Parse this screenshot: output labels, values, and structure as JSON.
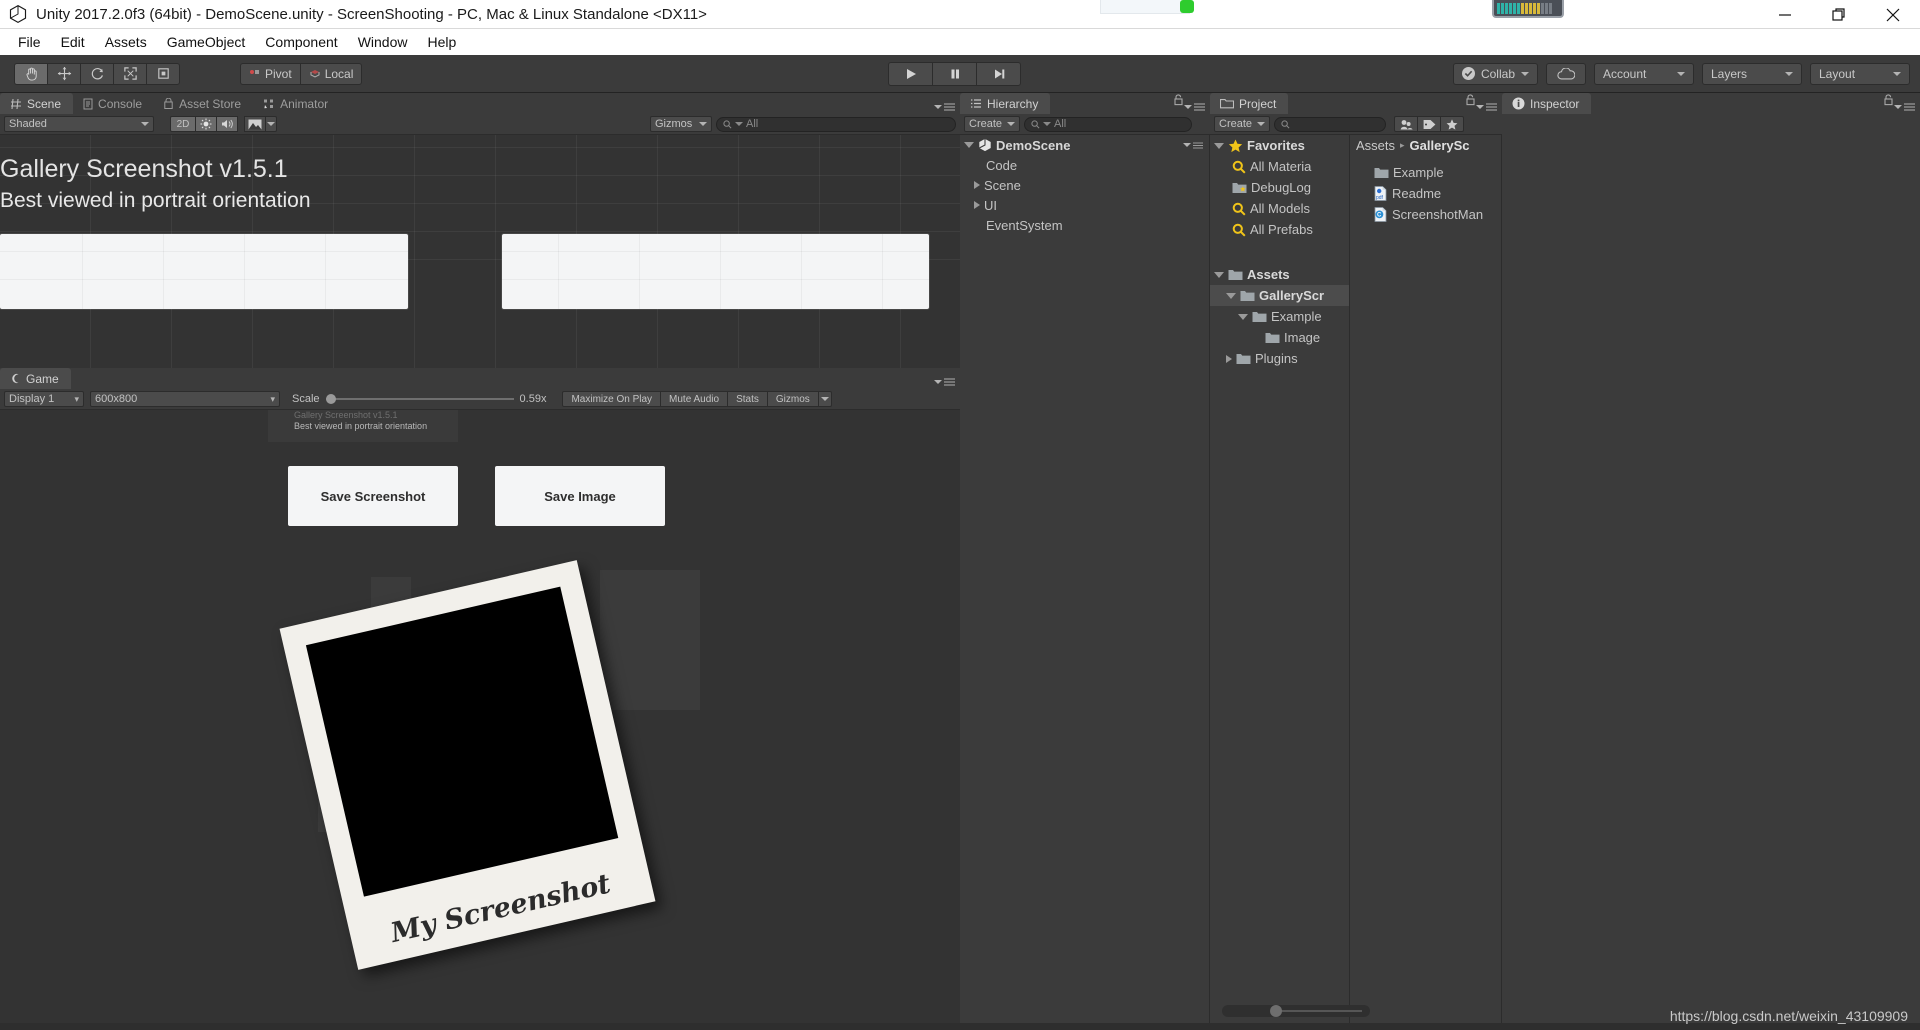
{
  "window": {
    "title": "Unity 2017.2.0f3 (64bit) - DemoScene.unity - ScreenShooting - PC, Mac & Linux Standalone <DX11>",
    "icon": "unity-logo-icon",
    "controls": {
      "minimize": "minimize-icon",
      "maximize": "maximize-icon",
      "close": "close-icon"
    }
  },
  "menubar": {
    "items": [
      "File",
      "Edit",
      "Assets",
      "GameObject",
      "Component",
      "Window",
      "Help"
    ]
  },
  "toolbar": {
    "transform_tools": [
      {
        "name": "hand-tool",
        "glyph": "hand-icon",
        "active": true
      },
      {
        "name": "move-tool",
        "glyph": "move-icon",
        "active": false
      },
      {
        "name": "rotate-tool",
        "glyph": "rotate-icon",
        "active": false
      },
      {
        "name": "scale-tool",
        "glyph": "scale-icon",
        "active": false
      },
      {
        "name": "rect-tool",
        "glyph": "rect-transform-icon",
        "active": false
      }
    ],
    "pivot_label": "Pivot",
    "local_label": "Local",
    "play_label": "play-icon",
    "pause_label": "pause-icon",
    "step_label": "step-icon",
    "collab_label": "Collab",
    "cloud_label": "cloud-icon",
    "account_label": "Account",
    "layers_label": "Layers",
    "layout_label": "Layout"
  },
  "scene": {
    "tabs": [
      {
        "label": "Scene",
        "icon": "scene-grid-icon",
        "active": true
      },
      {
        "label": "Console",
        "icon": "console-icon",
        "active": false
      },
      {
        "label": "Asset Store",
        "icon": "asset-store-icon",
        "active": false
      },
      {
        "label": "Animator",
        "icon": "animator-icon",
        "active": false
      }
    ],
    "shading_mode": "Shaded",
    "mode_2d": "2D",
    "lighting_icon": "sun-icon",
    "audio_icon": "speaker-icon",
    "fx_icon": "effects-icon",
    "gizmos_label": "Gizmos",
    "search_placeholder": "All",
    "canvas": {
      "title": "Gallery Screenshot v1.5.1",
      "subtitle": "Best viewed in portrait orientation"
    }
  },
  "game": {
    "tab_label": "Game",
    "tab_icon": "game-icon",
    "display": "Display 1",
    "resolution": "600x800",
    "scale_label": "Scale",
    "scale_value": "0.59x",
    "scale_fraction": 0.02,
    "maximize_on_play": "Maximize On Play",
    "mute_audio": "Mute Audio",
    "stats": "Stats",
    "gizmos": "Gizmos",
    "canvas": {
      "title": "Gallery Screenshot v1.5.1",
      "subtitle": "Best viewed in portrait orientation",
      "buttons": [
        {
          "label": "Save Screenshot"
        },
        {
          "label": "Save Image"
        }
      ],
      "polaroid_caption": "My Screenshot"
    }
  },
  "hierarchy": {
    "tab_label": "Hierarchy",
    "tab_icon": "hierarchy-icon",
    "create_label": "Create",
    "search_placeholder": "All",
    "lock_icon": "lock-icon",
    "menu_icon": "panel-menu-icon",
    "tree": [
      {
        "label": "DemoScene",
        "depth": 0,
        "expanded": true,
        "icon": "unity-scene-icon",
        "bold": true
      },
      {
        "label": "Code",
        "depth": 1,
        "expanded": null
      },
      {
        "label": "Scene",
        "depth": 1,
        "expanded": false
      },
      {
        "label": "UI",
        "depth": 1,
        "expanded": false
      },
      {
        "label": "EventSystem",
        "depth": 1,
        "expanded": null
      }
    ]
  },
  "project": {
    "tab_label": "Project",
    "tab_icon": "folder-icon",
    "create_label": "Create",
    "search_placeholder": "",
    "icons": [
      "filter-by-type-icon",
      "filter-by-label-icon",
      "filter-favorites-icon"
    ],
    "lock_icon": "lock-icon",
    "menu_icon": "panel-menu-icon",
    "tree": [
      {
        "label": "Favorites",
        "depth": 0,
        "expanded": true,
        "icon": "star-icon",
        "bold": true
      },
      {
        "label": "All Materia",
        "depth": 1,
        "icon": "search-icon"
      },
      {
        "label": "DebugLog",
        "depth": 1,
        "icon": "saved-search-icon"
      },
      {
        "label": "All Models",
        "depth": 1,
        "icon": "search-icon"
      },
      {
        "label": "All Prefabs",
        "depth": 1,
        "icon": "search-icon"
      },
      {
        "label": "",
        "depth": 0,
        "icon": "spacer"
      },
      {
        "label": "Assets",
        "depth": 0,
        "expanded": true,
        "icon": "folder-icon",
        "bold": true
      },
      {
        "label": "GalleryScr",
        "depth": 1,
        "expanded": true,
        "icon": "folder-icon",
        "bold": true,
        "selected": true
      },
      {
        "label": "Example",
        "depth": 2,
        "expanded": true,
        "icon": "folder-icon"
      },
      {
        "label": "Image",
        "depth": 3,
        "icon": "folder-icon"
      },
      {
        "label": "Plugins",
        "depth": 1,
        "expanded": false,
        "icon": "folder-icon"
      }
    ],
    "breadcrumb": [
      "Assets",
      "GallerySc"
    ],
    "contents": [
      {
        "label": "Example",
        "icon": "folder-icon"
      },
      {
        "label": "Readme",
        "icon": "pdf-file-icon"
      },
      {
        "label": "ScreenshotMan",
        "icon": "csharp-script-icon"
      }
    ],
    "scrollbar": "horizontal-scrollbar"
  },
  "inspector": {
    "tab_label": "Inspector",
    "tab_icon": "info-icon",
    "lock_icon": "lock-icon",
    "menu_icon": "panel-menu-icon"
  },
  "watermark": "https://blog.csdn.net/weixin_43109909",
  "colors": {
    "panel_bg": "#3b3b3b",
    "viewport_bg": "#333333",
    "tab_active": "#4b4b4b",
    "text": "#c4c4c4",
    "accent_yellow": "#f0c419",
    "green_badge": "#2ecc2e"
  }
}
